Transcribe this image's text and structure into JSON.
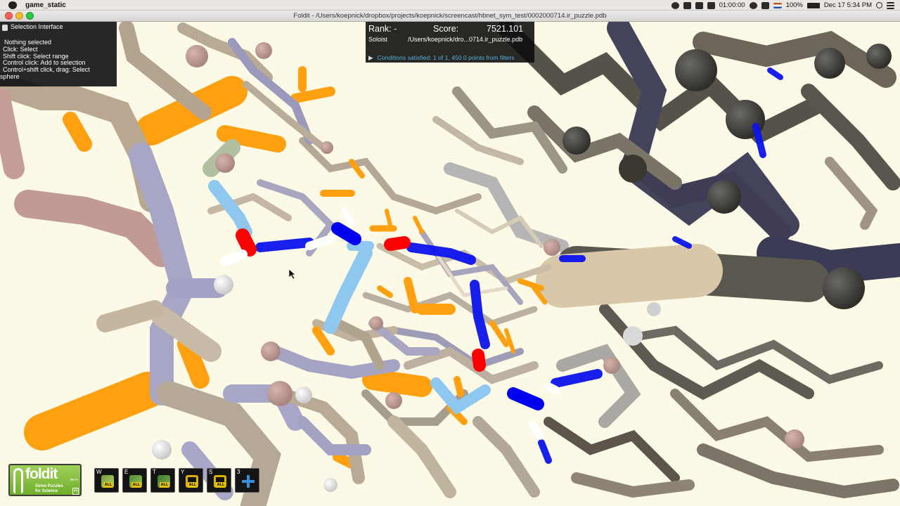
{
  "menubar": {
    "app_name": "game_static",
    "timer": "01:00:00",
    "battery": "100%",
    "datetime": "Dec 17  5:34 PM",
    "icons": [
      "apple-logo",
      "record-icon",
      "camera-icon",
      "dropbox-icon",
      "battery-icon",
      "wifi-icon",
      "volume-icon",
      "flag-icon",
      "search-icon",
      "list-icon"
    ]
  },
  "window": {
    "title": "Foldit - /Users/koepnick/dropbox/projects/koepnick/screencast/hbnet_sym_test/0002000714.ir_puzzle.pdb"
  },
  "selection_panel": {
    "title": "Selection Interface",
    "lines": [
      "Nothing selected",
      "Click: Select",
      "Shift click: Select range",
      "Control click: Add to selection",
      "Control+shift click, drag: Select"
    ],
    "wrap_line": "sphere"
  },
  "score_panel": {
    "rank_label": "Rank: -",
    "score_label": "Score:",
    "score_value": "7521.101",
    "player": "Soloist",
    "file": "/Users/koepnick/dro...0714.ir_puzzle.pdb",
    "conditions": "Conditions satisfied: 1 of 1, 450.0 points from filters"
  },
  "logo": {
    "brand": "foldit",
    "beta": "BETA",
    "tagline_1": "Solve Puzzles",
    "tagline_2": "for Science",
    "hotkey": "H"
  },
  "toolbar": [
    {
      "key": "W",
      "action": "wiggle-all",
      "badge": "ALL"
    },
    {
      "key": "E",
      "action": "shake-all",
      "badge": "ALL"
    },
    {
      "key": "T",
      "action": "tweak-all",
      "badge": "ALL"
    },
    {
      "key": "Y",
      "action": "lock-all",
      "badge": "ALL"
    },
    {
      "key": "S",
      "action": "unlock-all",
      "badge": "ALL"
    },
    {
      "key": "3",
      "action": "move-view",
      "badge": ""
    }
  ],
  "colors": {
    "background": "#fcfae6",
    "carbon": "#c9b9a3",
    "nitrogen_backbone": "#9a9ac4",
    "oxygen_backbone": "#c89a94",
    "hydrophobic": "#ffa010",
    "hbond": "#0a10f0",
    "nitrogen": "#0000f0",
    "oxygen": "#ff0000",
    "hydrogen": "#ffffff",
    "highlight_chain": "#8ec8f0",
    "far_atoms": "#4a4740"
  }
}
